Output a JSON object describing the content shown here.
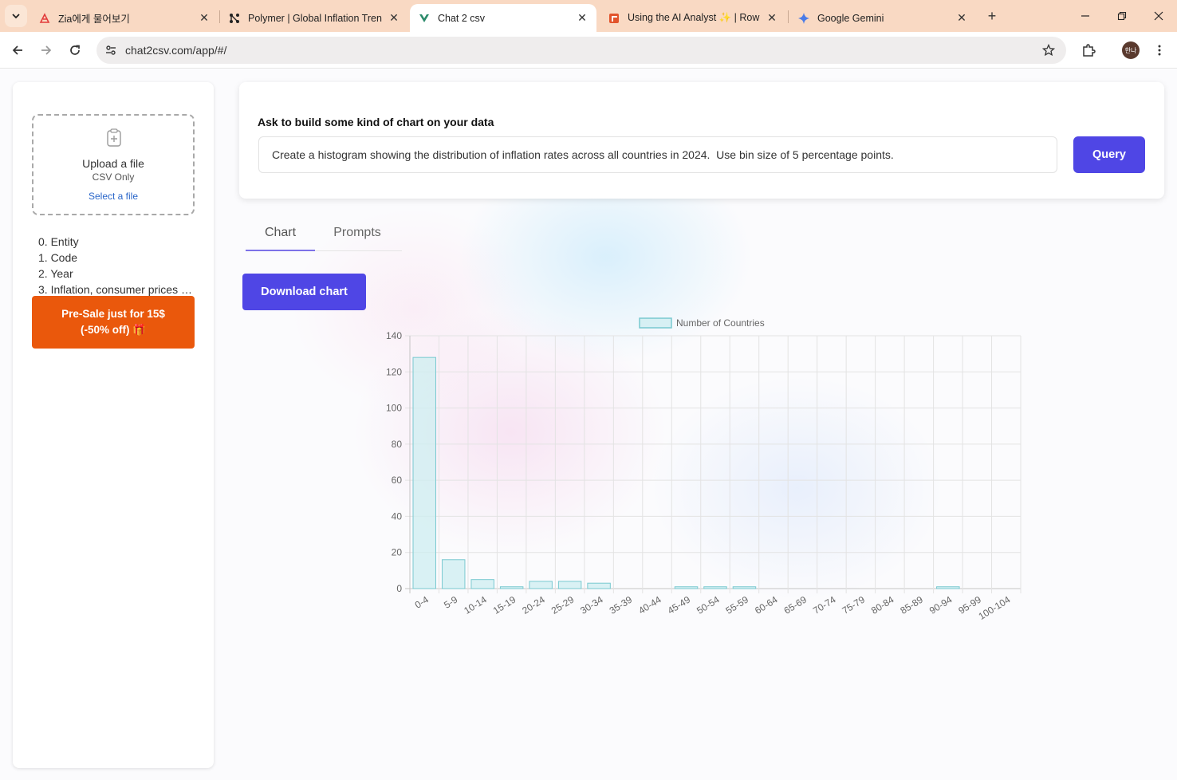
{
  "browser": {
    "tabs": [
      {
        "title": "Zia에게 물어보기",
        "active": false
      },
      {
        "title": "Polymer | Global Inflation Tren",
        "active": false
      },
      {
        "title": "Chat 2 csv",
        "active": true
      },
      {
        "title": "Using the AI Analyst ✨ | Row",
        "active": false
      },
      {
        "title": "Google Gemini",
        "active": false
      }
    ],
    "url": "chat2csv.com/app/#/",
    "profile_initials": "한나"
  },
  "sidebar": {
    "upload_title": "Upload a file",
    "upload_subtitle": "CSV Only",
    "upload_link": "Select a file",
    "columns": [
      "0. Entity",
      "1. Code",
      "2. Year",
      "3. Inflation, consumer prices (annual %)"
    ],
    "presale_line1": "Pre-Sale just for 15$",
    "presale_line2": "(-50% off) 🎁"
  },
  "query": {
    "label": "Ask to build some kind of chart on your data",
    "value": "Create a histogram showing the distribution of inflation rates across all countries in 2024.  Use bin size of 5 percentage points.",
    "button": "Query"
  },
  "panel_tabs": {
    "chart": "Chart",
    "prompts": "Prompts"
  },
  "download_button": "Download chart",
  "colors": {
    "accent": "#4f46e5",
    "presale": "#ea580c",
    "bar_fill": "#cdeef0",
    "bar_stroke": "#79c9d0"
  },
  "chart_data": {
    "type": "bar",
    "categories": [
      "0-4",
      "5-9",
      "10-14",
      "15-19",
      "20-24",
      "25-29",
      "30-34",
      "35-39",
      "40-44",
      "45-49",
      "50-54",
      "55-59",
      "60-64",
      "65-69",
      "70-74",
      "75-79",
      "80-84",
      "85-89",
      "90-94",
      "95-99",
      "100-104"
    ],
    "series": [
      {
        "name": "Number of Countries",
        "values": [
          128,
          16,
          5,
          1,
          4,
          4,
          3,
          0,
          0,
          1,
          1,
          1,
          0,
          0,
          0,
          0,
          0,
          0,
          1,
          0,
          0
        ]
      }
    ],
    "ylim": [
      0,
      140
    ],
    "yticks": [
      0,
      20,
      40,
      60,
      80,
      100,
      120,
      140
    ],
    "grid": true,
    "legend": "top-center"
  }
}
